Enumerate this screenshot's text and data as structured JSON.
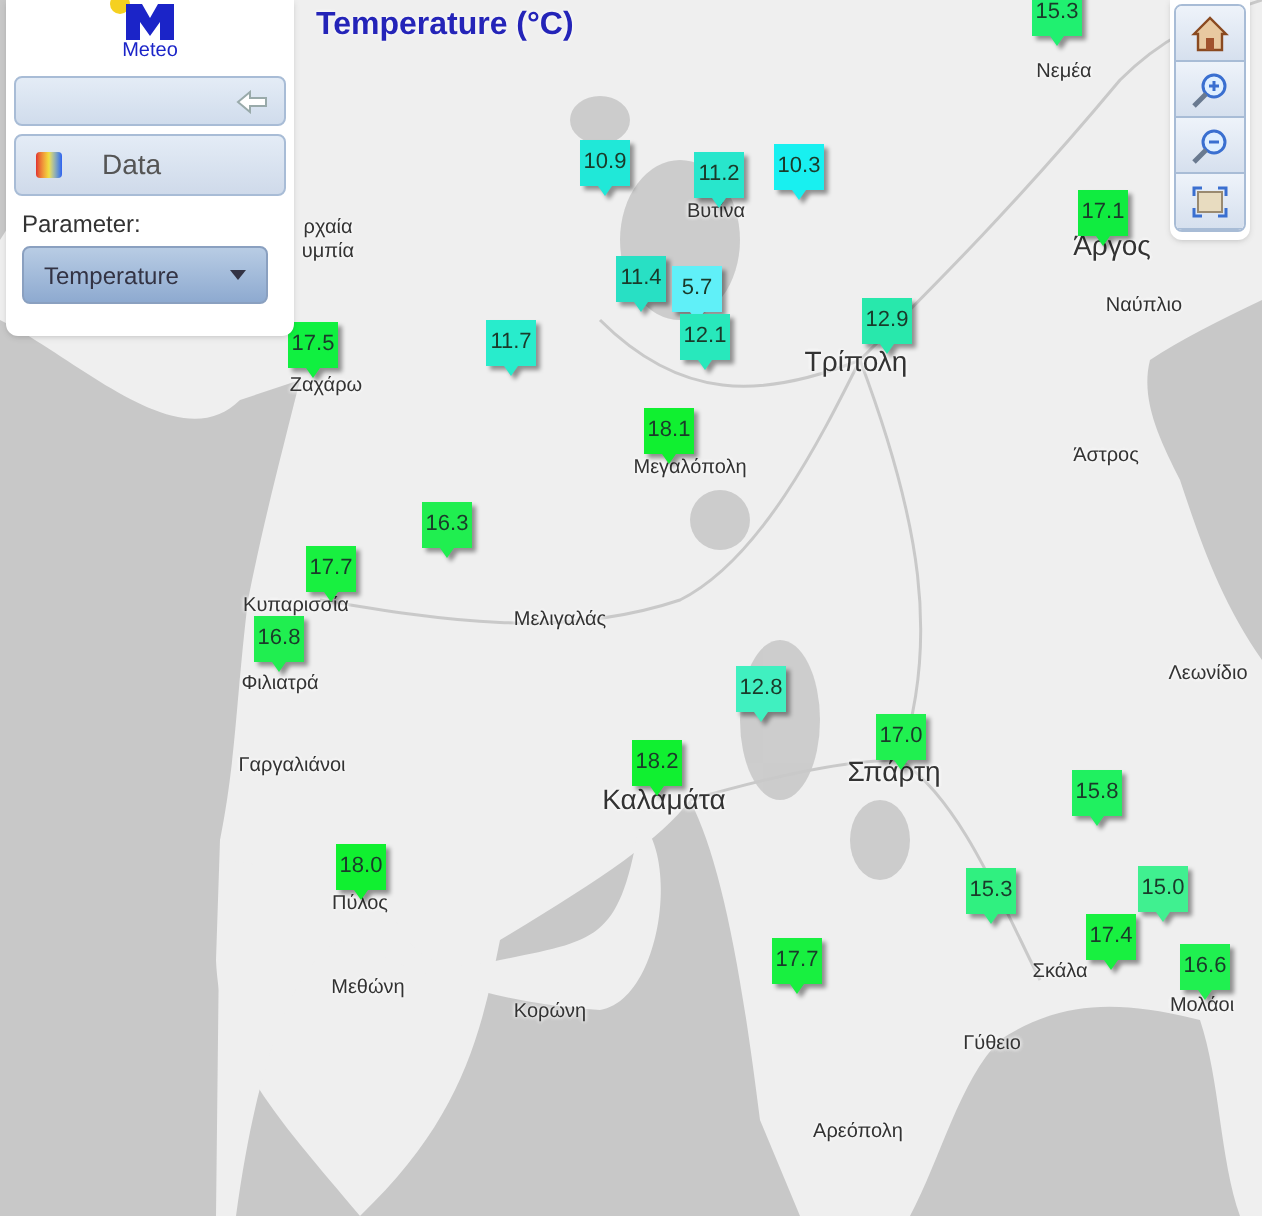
{
  "title": "Temperature (°C)",
  "panel": {
    "logo_text": "Meteo",
    "data_button": "Data",
    "parameter_label": "Parameter:",
    "parameter_value": "Temperature"
  },
  "toolbar": [
    {
      "kind": "home"
    },
    {
      "kind": "zoom-in"
    },
    {
      "kind": "zoom-out"
    },
    {
      "kind": "extent"
    }
  ],
  "places": [
    {
      "name": "Νεμέα"
    },
    {
      "name": "Βυτίνα"
    },
    {
      "name": "Άργος"
    },
    {
      "name": "ρχαία"
    },
    {
      "name": "υμπία"
    },
    {
      "name": "Ναύπλιο"
    },
    {
      "name": "Τρίπολη"
    },
    {
      "name": "Ζαχάρω"
    },
    {
      "name": "Άστρος"
    },
    {
      "name": "Μεγαλόπολη"
    },
    {
      "name": "Κυπαρισσία"
    },
    {
      "name": "Μελιγαλάς"
    },
    {
      "name": "Λεωνίδιο"
    },
    {
      "name": "Φιλιατρά"
    },
    {
      "name": "Σπάρτη"
    },
    {
      "name": "Γαργαλιάνοι"
    },
    {
      "name": "Καλαμάτα"
    },
    {
      "name": "Πύλος"
    },
    {
      "name": "Σκάλα"
    },
    {
      "name": "Μεθώνη"
    },
    {
      "name": "Μολάοι"
    },
    {
      "name": "Κορώνη"
    },
    {
      "name": "Γύθειο"
    },
    {
      "name": "Αρεόπολη"
    }
  ],
  "stations": [
    {
      "value": "15.3",
      "color": "#20f070"
    },
    {
      "value": "10.9",
      "color": "#20e8d8"
    },
    {
      "value": "11.2",
      "color": "#28e6cc"
    },
    {
      "value": "10.3",
      "color": "#18f0f0"
    },
    {
      "value": "17.1",
      "color": "#10ec40"
    },
    {
      "value": "11.4",
      "color": "#28e0c4"
    },
    {
      "value": "5.7",
      "color": "#60f0f8"
    },
    {
      "value": "17.5",
      "color": "#10f040"
    },
    {
      "value": "11.7",
      "color": "#28eccc"
    },
    {
      "value": "12.1",
      "color": "#28e8bc"
    },
    {
      "value": "12.9",
      "color": "#28e8ac"
    },
    {
      "value": "18.1",
      "color": "#10f030"
    },
    {
      "value": "16.3",
      "color": "#20ee50"
    },
    {
      "value": "17.7",
      "color": "#18f040"
    },
    {
      "value": "16.8",
      "color": "#20ee50"
    },
    {
      "value": "12.8",
      "color": "#40f0c0"
    },
    {
      "value": "17.0",
      "color": "#20f050"
    },
    {
      "value": "18.2",
      "color": "#10f030"
    },
    {
      "value": "15.8",
      "color": "#20f060"
    },
    {
      "value": "18.0",
      "color": "#10f030"
    },
    {
      "value": "15.3",
      "color": "#30f080"
    },
    {
      "value": "15.0",
      "color": "#40f090"
    },
    {
      "value": "17.4",
      "color": "#18f040"
    },
    {
      "value": "17.7",
      "color": "#18f040"
    },
    {
      "value": "16.6",
      "color": "#20f050"
    }
  ]
}
